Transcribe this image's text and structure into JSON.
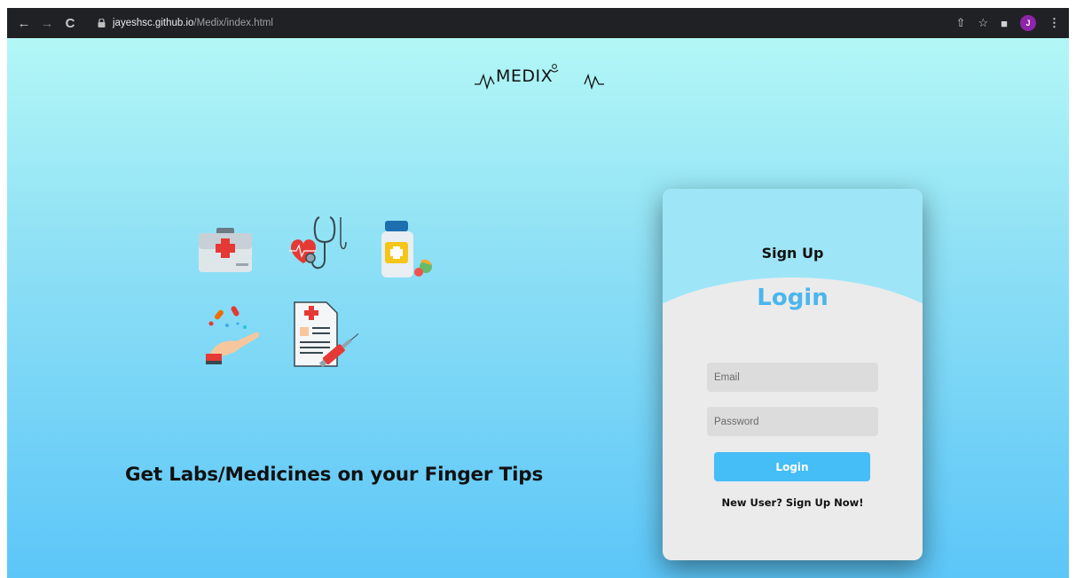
{
  "browser": {
    "url_host": "jayeshsc.github.io",
    "url_path": "/Medix/index.html",
    "avatar_letter": "J"
  },
  "brand": {
    "logo_text": "MEDIX"
  },
  "hero": {
    "tagline": "Get Labs/Medicines on your Finger Tips"
  },
  "auth": {
    "signup_title": "Sign Up",
    "login_title": "Login",
    "email_placeholder": "Email",
    "password_placeholder": "Password",
    "login_button": "Login",
    "switch_text": "New User? Sign Up Now!"
  },
  "colors": {
    "accent": "#45bdf6",
    "login_title": "#4ab6ee",
    "card_bg": "#ebebeb",
    "chrome_bg": "#202124"
  }
}
